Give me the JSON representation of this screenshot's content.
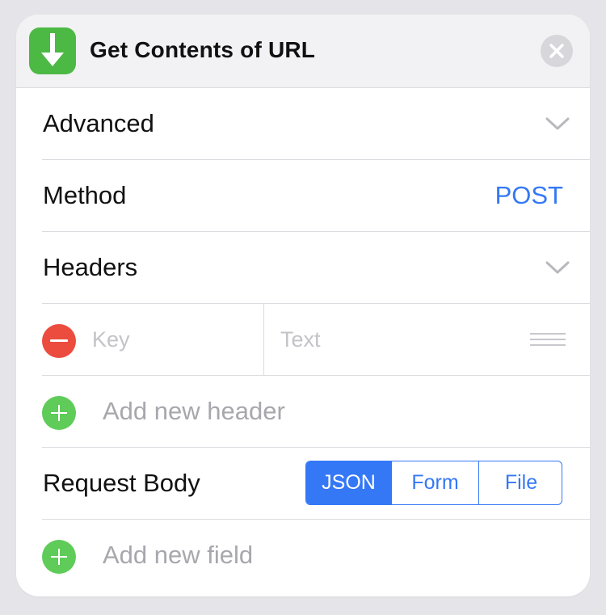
{
  "header": {
    "title": "Get Contents of URL",
    "icon": "download-arrow-icon",
    "accent": "#4cb944"
  },
  "advanced": {
    "label": "Advanced"
  },
  "method": {
    "label": "Method",
    "value": "POST"
  },
  "headers": {
    "label": "Headers",
    "entry": {
      "key_placeholder": "Key",
      "value_placeholder": "Text"
    },
    "add_label": "Add new header"
  },
  "request_body": {
    "label": "Request Body",
    "options": [
      "JSON",
      "Form",
      "File"
    ],
    "selected": "JSON",
    "add_label": "Add new field"
  },
  "colors": {
    "accent_blue": "#3478f6",
    "remove_red": "#ec4c3e",
    "add_green": "#5fcc5a"
  }
}
